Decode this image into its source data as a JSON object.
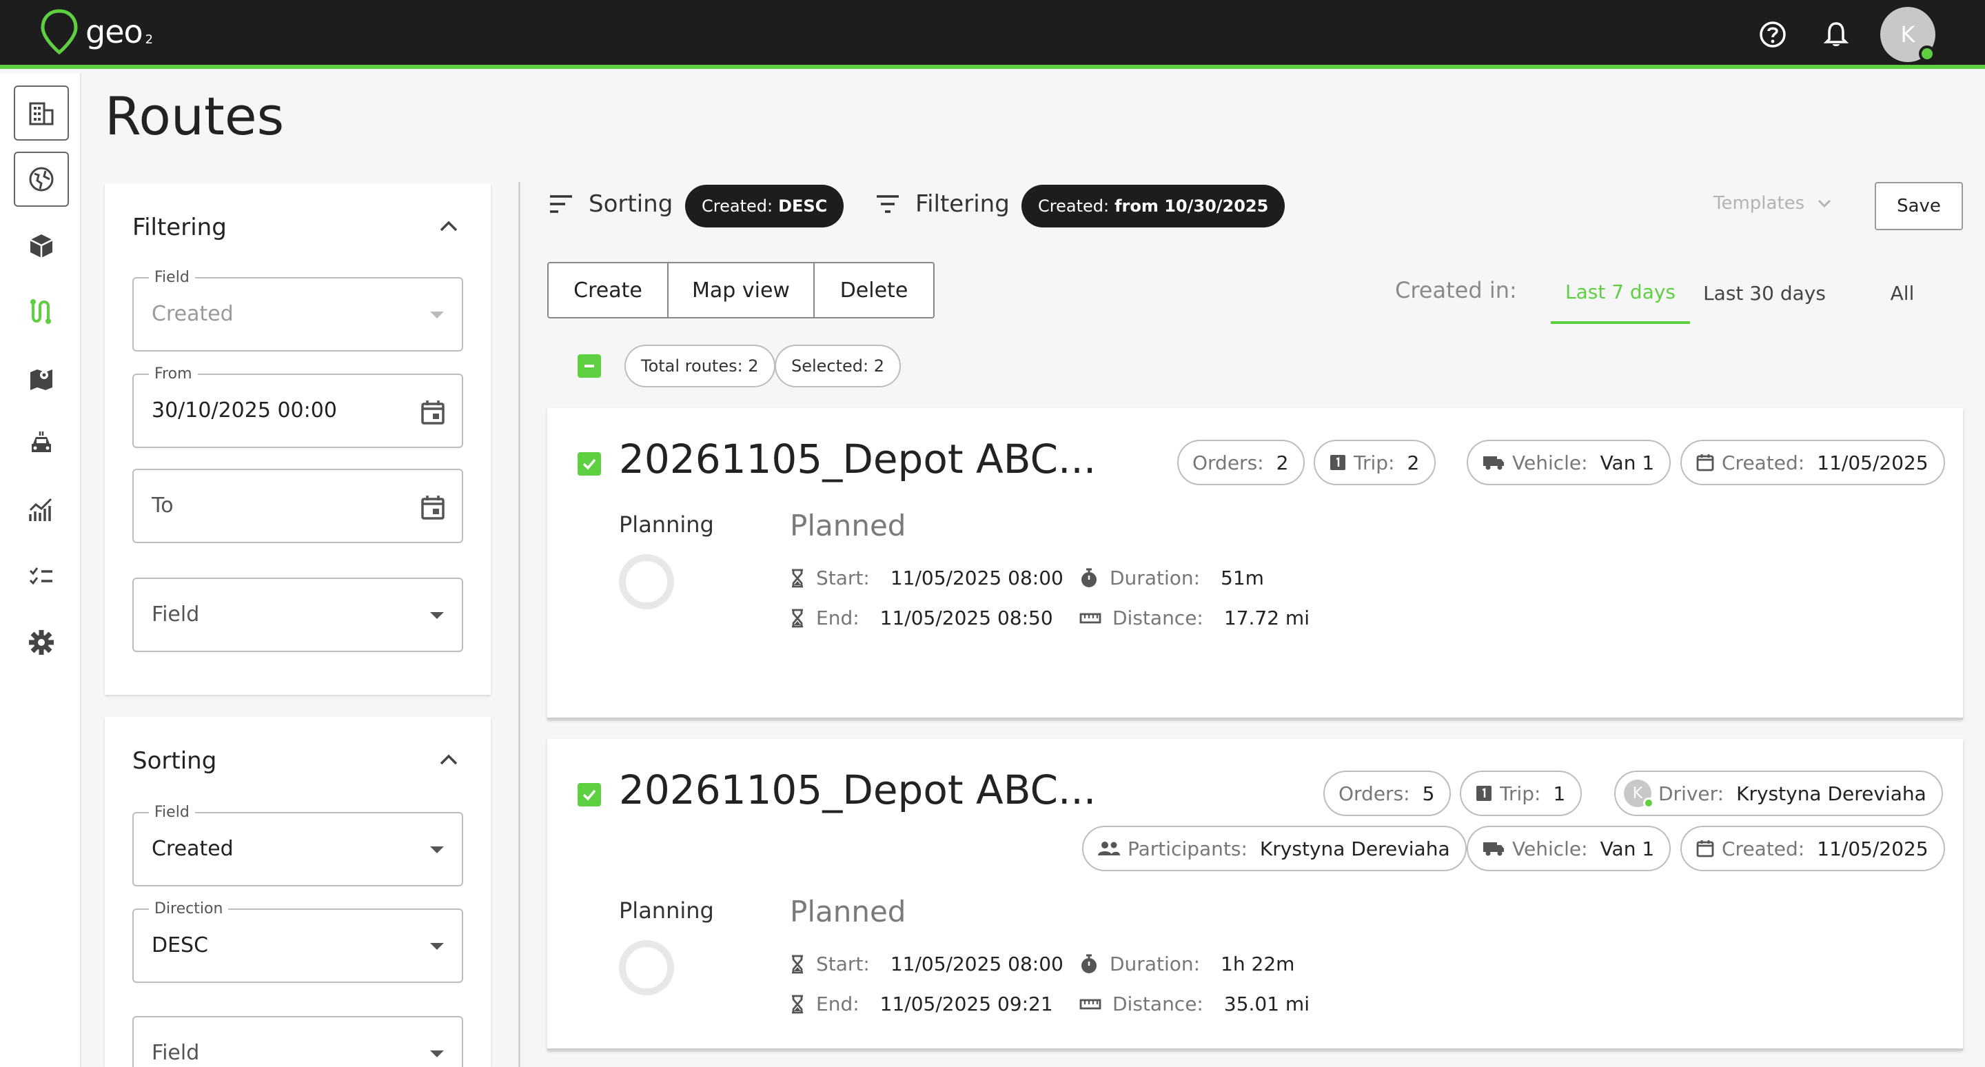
{
  "app": {
    "logo_text": "geo",
    "logo_sub": "2",
    "user_initial": "K"
  },
  "page": {
    "title": "Routes"
  },
  "filter_panel": {
    "title": "Filtering",
    "field_label": "Field",
    "field_value": "Created",
    "from_label": "From",
    "from_value": "30/10/2025 00:00",
    "to_placeholder": "To",
    "extra_field": "Field"
  },
  "sort_panel": {
    "title": "Sorting",
    "field_label": "Field",
    "field_value": "Created",
    "direction_label": "Direction",
    "direction_value": "DESC",
    "extra_field": "Field"
  },
  "toolbar": {
    "sorting_label": "Sorting",
    "sorting_pill_key": "Created:",
    "sorting_pill_value": "DESC",
    "filtering_label": "Filtering",
    "filtering_pill_key": "Created:",
    "filtering_pill_value": "from 10/30/2025",
    "templates_label": "Templates",
    "save_label": "Save"
  },
  "actions": {
    "create": "Create",
    "map_view": "Map view",
    "delete": "Delete"
  },
  "created_in": {
    "label": "Created in:",
    "tabs": [
      "Last 7 days",
      "Last 30 days",
      "All"
    ],
    "active_tab": "Last 7 days"
  },
  "summary": {
    "total_routes": "Total routes: 2",
    "selected": "Selected: 2"
  },
  "routes": [
    {
      "title": "20261105_Depot ABC...",
      "orders_label": "Orders:",
      "orders": "2",
      "trip_label": "Trip:",
      "trip": "2",
      "vehicle_label": "Vehicle:",
      "vehicle": "Van 1",
      "created_label": "Created:",
      "created": "11/05/2025",
      "planning_label": "Planning",
      "status": "Planned",
      "start_label": "Start:",
      "start": "11/05/2025 08:00",
      "end_label": "End:",
      "end": "11/05/2025 08:50",
      "duration_label": "Duration:",
      "duration": "51m",
      "distance_label": "Distance:",
      "distance": "17.72 mi"
    },
    {
      "title": "20261105_Depot ABC...",
      "orders_label": "Orders:",
      "orders": "5",
      "trip_label": "Trip:",
      "trip": "1",
      "driver_label": "Driver:",
      "driver": "Krystyna Dereviaha",
      "driver_initial": "K",
      "participants_label": "Participants:",
      "participants": "Krystyna Dereviaha",
      "vehicle_label": "Vehicle:",
      "vehicle": "Van 1",
      "created_label": "Created:",
      "created": "11/05/2025",
      "planning_label": "Planning",
      "status": "Planned",
      "start_label": "Start:",
      "start": "11/05/2025 08:00",
      "end_label": "End:",
      "end": "11/05/2025 09:21",
      "duration_label": "Duration:",
      "duration": "1h 22m",
      "distance_label": "Distance:",
      "distance": "35.01 mi"
    }
  ],
  "colors": {
    "accent": "#5fcf42",
    "topbar": "#1d1d1d",
    "pill_dark": "#1d1d1d"
  },
  "icons": [
    "geo-pin-icon",
    "help-icon",
    "bell-icon",
    "buildings-icon",
    "globe-icon",
    "package-icon",
    "route-icon",
    "map-icon",
    "vehicle-icon",
    "analytics-icon",
    "checklist-icon",
    "settings-icon",
    "calendar-icon",
    "sort-icon",
    "filter-icon",
    "hourglass-icon",
    "stopwatch-icon",
    "ruler-icon",
    "truck-icon",
    "people-icon",
    "trip-icon"
  ]
}
